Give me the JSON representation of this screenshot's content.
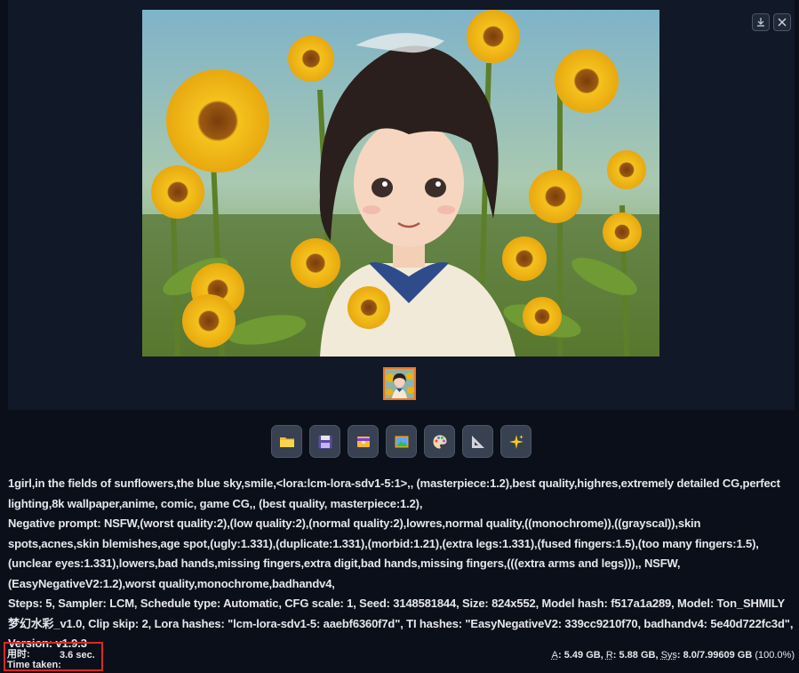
{
  "gallery": {
    "download_icon": "download-icon",
    "close_icon": "close-icon"
  },
  "toolbar": {
    "buttons": [
      {
        "name": "open-folder-button",
        "icon": "folder-icon"
      },
      {
        "name": "save-button",
        "icon": "floppy-disk-icon"
      },
      {
        "name": "zip-button",
        "icon": "archive-icon"
      },
      {
        "name": "send-to-img2img-button",
        "icon": "picture-icon"
      },
      {
        "name": "send-to-inpaint-button",
        "icon": "palette-icon"
      },
      {
        "name": "send-to-extras-button",
        "icon": "triangle-ruler-icon"
      },
      {
        "name": "send-to-upscale-button",
        "icon": "sparkles-icon"
      }
    ]
  },
  "info": {
    "prompt": "1girl,in the fields of sunflowers,the blue sky,smile,<lora:lcm-lora-sdv1-5:1>,, (masterpiece:1.2),best quality,highres,extremely detailed CG,perfect lighting,8k wallpaper,anime, comic, game CG,, (best quality, masterpiece:1.2),",
    "negative": "Negative prompt: NSFW,(worst quality:2),(low quality:2),(normal quality:2),lowres,normal quality,((monochrome)),((grayscal)),skin spots,acnes,skin blemishes,age spot,(ugly:1.331),(duplicate:1.331),(morbid:1.21),(extra legs:1.331),(fused fingers:1.5),(too many fingers:1.5),(unclear eyes:1.331),lowers,bad hands,missing fingers,extra digit,bad hands,missing fingers,(((extra arms and legs))),, NSFW,(EasyNegativeV2:1.2),worst quality,monochrome,badhandv4,",
    "params": "Steps: 5, Sampler: LCM, Schedule type: Automatic, CFG scale: 1, Seed: 3148581844, Size: 824x552, Model hash: f517a1a289, Model: Ton_SHMILY梦幻水彩_v1.0, Clip skip: 2, Lora hashes: \"lcm-lora-sdv1-5: aaebf6360f7d\", TI hashes: \"EasyNegativeV2: 339cc9210f70, badhandv4: 5e40d722fc3d\", Version: v1.9.3"
  },
  "footer": {
    "time_label": "用时:",
    "time_label_en": "Time taken:",
    "time_value": "3.6 sec.",
    "mem_a_key": "A",
    "mem_a_val": ": 5.49 GB, ",
    "mem_r_key": "R",
    "mem_r_val": ": 5.88 GB, ",
    "mem_sys_key": "Sys",
    "mem_sys_val": ": 8.0/7.99609 GB ",
    "mem_pct": "(100.0%)"
  },
  "colors": {
    "background": "#0b0f19",
    "panel": "#111827",
    "accent": "#f97316",
    "highlight_box": "#dc2626"
  }
}
